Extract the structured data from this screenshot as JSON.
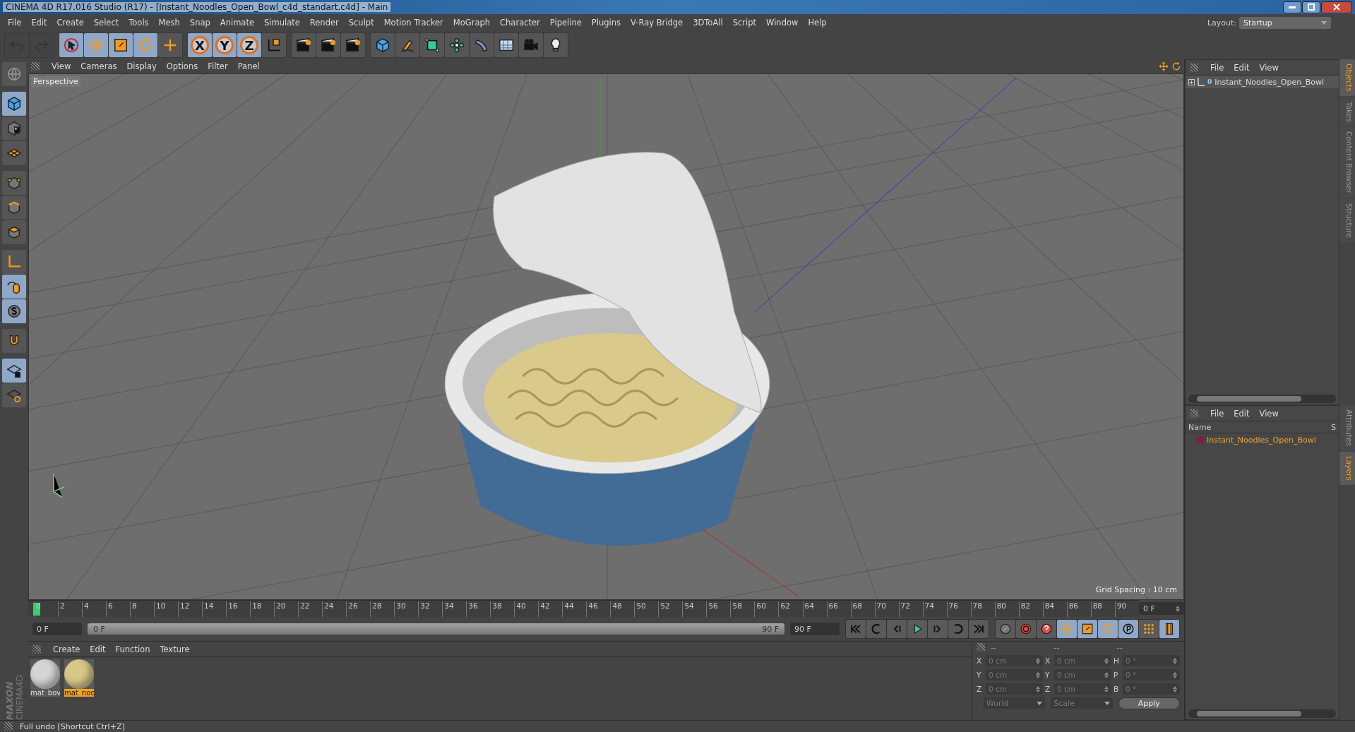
{
  "window": {
    "title": "CINEMA 4D R17.016 Studio (R17) - [Instant_Noodles_Open_Bowl_c4d_standart.c4d] - Main"
  },
  "menu": [
    "File",
    "Edit",
    "Create",
    "Select",
    "Tools",
    "Mesh",
    "Snap",
    "Animate",
    "Simulate",
    "Render",
    "Sculpt",
    "Motion Tracker",
    "MoGraph",
    "Character",
    "Pipeline",
    "Plugins",
    "V-Ray Bridge",
    "3DToAll",
    "Script",
    "Window",
    "Help"
  ],
  "layout": {
    "label": "Layout:",
    "value": "Startup"
  },
  "toolbar": [
    [
      {
        "kind": "icon",
        "active": false,
        "disabled": true
      },
      {
        "kind": "icon",
        "active": false,
        "disabled": true
      }
    ],
    [
      {
        "kind": "icon",
        "active": true,
        "disabled": false
      },
      {
        "kind": "icon",
        "active": true,
        "disabled": false
      },
      {
        "kind": "icon",
        "active": true,
        "disabled": false
      },
      {
        "kind": "icon",
        "active": true,
        "disabled": false
      },
      {
        "kind": "icon",
        "active": false,
        "disabled": false
      }
    ],
    [
      {
        "kind": "axis",
        "label": "X",
        "active": true,
        "disabled": false
      },
      {
        "kind": "axis",
        "label": "Y",
        "active": true,
        "disabled": false
      },
      {
        "kind": "axis",
        "label": "Z",
        "active": true,
        "disabled": false
      },
      {
        "kind": "icon",
        "active": false,
        "disabled": false
      }
    ],
    [
      {
        "kind": "icon",
        "active": false,
        "disabled": false
      },
      {
        "kind": "icon",
        "active": false,
        "disabled": false
      },
      {
        "kind": "icon",
        "active": false,
        "disabled": false
      }
    ],
    [
      {
        "kind": "icon",
        "active": false,
        "disabled": false
      },
      {
        "kind": "icon",
        "active": false,
        "disabled": false
      },
      {
        "kind": "icon",
        "active": false,
        "disabled": false
      },
      {
        "kind": "icon",
        "active": false,
        "disabled": false
      },
      {
        "kind": "icon",
        "active": false,
        "disabled": false
      },
      {
        "kind": "icon",
        "active": false,
        "disabled": false
      },
      {
        "kind": "icon",
        "active": false,
        "disabled": false
      },
      {
        "kind": "icon",
        "active": false,
        "disabled": false
      }
    ]
  ],
  "left_toolbar": [
    [
      {
        "active": false
      }
    ],
    [
      {
        "active": true
      },
      {
        "active": false
      },
      {
        "active": false
      }
    ],
    [
      {
        "active": false
      },
      {
        "active": false
      },
      {
        "active": false
      }
    ],
    [
      {
        "active": false
      },
      {
        "active": true
      },
      {
        "active": true
      }
    ],
    [
      {
        "active": false
      }
    ],
    [
      {
        "active": true
      },
      {
        "active": false
      }
    ]
  ],
  "viewport": {
    "menu": [
      "View",
      "Cameras",
      "Display",
      "Options",
      "Filter",
      "Panel"
    ],
    "camera": "Perspective",
    "grid_spacing": "Grid Spacing : 10 cm"
  },
  "objects_panel": {
    "menu": [
      "File",
      "Edit",
      "View"
    ],
    "objects": [
      {
        "name": "Instant_Noodles_Open_Bowl",
        "badge": "0"
      }
    ],
    "tabs": [
      {
        "label": "Objects",
        "selected": true
      },
      {
        "label": "Takes",
        "selected": false
      },
      {
        "label": "Content Browser",
        "selected": false
      },
      {
        "label": "Structure",
        "selected": false
      }
    ]
  },
  "layers_panel": {
    "menu": [
      "File",
      "Edit",
      "View"
    ],
    "columns": [
      "Name",
      "S"
    ],
    "layers": [
      {
        "name": "Instant_Noodles_Open_Bowl",
        "color": "#8b1a3c"
      }
    ],
    "tabs": [
      {
        "label": "Attributes",
        "selected": false
      },
      {
        "label": "Layers",
        "selected": true
      }
    ]
  },
  "timeline": {
    "ticks": [
      "0",
      "2",
      "4",
      "6",
      "8",
      "10",
      "12",
      "14",
      "16",
      "18",
      "20",
      "22",
      "24",
      "26",
      "28",
      "30",
      "32",
      "34",
      "36",
      "38",
      "40",
      "42",
      "44",
      "46",
      "48",
      "50",
      "52",
      "54",
      "56",
      "58",
      "60",
      "62",
      "64",
      "66",
      "68",
      "70",
      "72",
      "74",
      "76",
      "78",
      "80",
      "82",
      "84",
      "86",
      "88",
      "90"
    ],
    "current_frame": "0 F",
    "start": "0 F",
    "range": {
      "start": "0 F",
      "end": "90 F",
      "level": 1
    },
    "end": "90 F"
  },
  "transport": [
    {
      "active": false
    },
    {
      "active": false
    },
    {
      "active": false
    },
    {
      "active": false
    },
    {
      "active": false
    },
    {
      "active": false
    },
    {
      "active": false
    }
  ],
  "key_tools": [
    {
      "active": false
    },
    {
      "active": false
    },
    {
      "active": false
    },
    {
      "active": true
    },
    {
      "active": true
    },
    {
      "active": true
    },
    {
      "active": true
    },
    {
      "active": false
    },
    {
      "active": true
    }
  ],
  "materials": {
    "menu": [
      "Create",
      "Edit",
      "Function",
      "Texture"
    ],
    "items": [
      {
        "name": "mat_bov",
        "color": "#d4d4d4",
        "selected": false
      },
      {
        "name": "mat_noc",
        "color": "#d8c886",
        "selected": true
      }
    ]
  },
  "coordinates": {
    "headers": [
      "--",
      "--",
      "--"
    ],
    "rows": [
      {
        "pos_axis": "X",
        "pos": "0 cm",
        "size_axis": "X",
        "size": "0 cm",
        "rot_axis": "H",
        "rot": "0 °"
      },
      {
        "pos_axis": "Y",
        "pos": "0 cm",
        "size_axis": "Y",
        "size": "0 cm",
        "rot_axis": "P",
        "rot": "0 °"
      },
      {
        "pos_axis": "Z",
        "pos": "0 cm",
        "size_axis": "Z",
        "size": "0 cm",
        "rot_axis": "B",
        "rot": "0 °"
      }
    ],
    "space": "World",
    "mode": "Scale",
    "apply": "Apply"
  },
  "logo": {
    "brand": "MAXON",
    "product": "CINEMA4D"
  },
  "status_bar": "Full undo [Shortcut Ctrl+Z]"
}
